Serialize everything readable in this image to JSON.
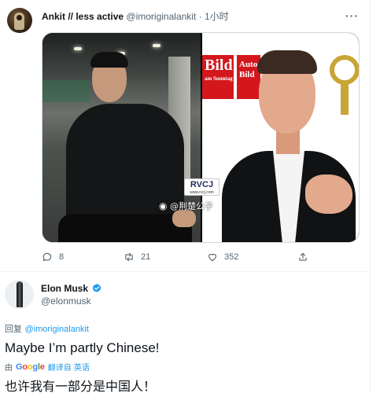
{
  "tweet1": {
    "author_name": "Ankit // less active",
    "author_handle": "@imoriginalankit",
    "separator": "·",
    "time": "1小时",
    "more_label": "···",
    "media": {
      "left_image": "man-in-parking-garage-photo",
      "right_image": "elon-musk-photo",
      "watermark_logo": "RVCJ",
      "watermark_url": "www.rvcj.com",
      "bild_banner_1_big": "Bild",
      "bild_banner_1_small": "am Sonntag",
      "bild_banner_2_big": "Auto Bild",
      "weibo_mark": "@荆楚公子"
    },
    "actions": {
      "reply_count": "8",
      "retweet_count": "21",
      "like_count": "352"
    }
  },
  "tweet2": {
    "author_name": "Elon Musk",
    "verified": true,
    "author_handle": "@elonmusk",
    "reply_prefix": "回复",
    "reply_to": "@imoriginalankit",
    "text": "Maybe I’m partly Chinese!",
    "translation": {
      "by_label": "由",
      "provider": "Google",
      "translated_from_label": "翻译自 英语",
      "text": "也许我有一部分是中国人！"
    }
  },
  "colors": {
    "accent": "#1d9bf0",
    "secondary_text": "#536471",
    "primary_text": "#0f1419",
    "bild_red": "#d3171c"
  }
}
